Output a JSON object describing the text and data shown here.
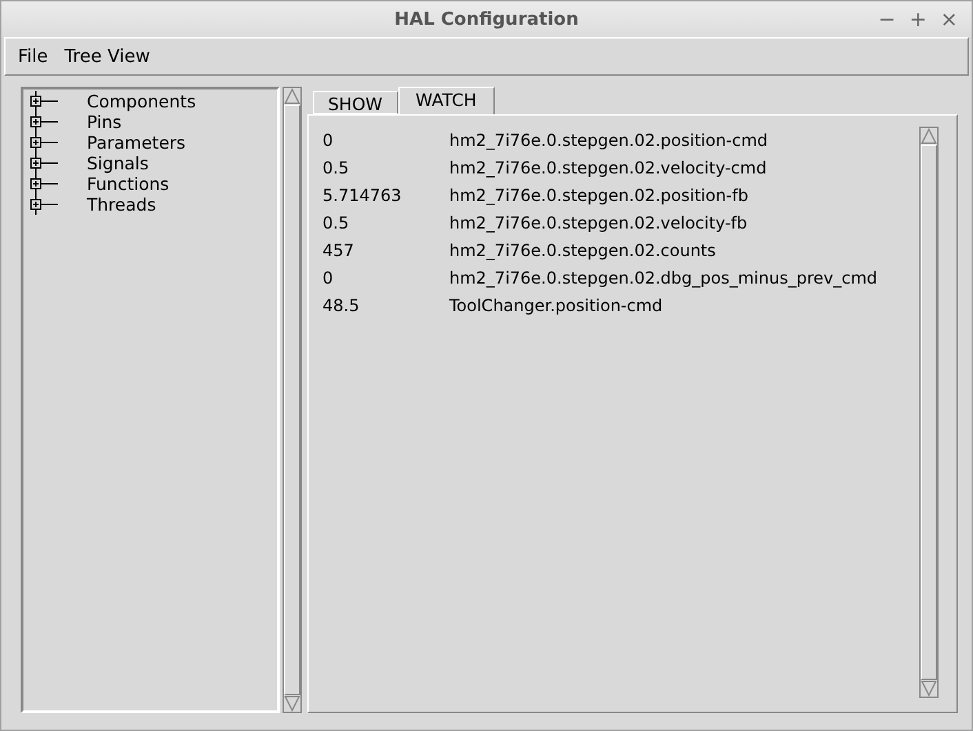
{
  "window": {
    "title": "HAL Configuration",
    "controls": [
      "−",
      "+",
      "×"
    ]
  },
  "menu": [
    "File",
    "Tree View"
  ],
  "tree": {
    "items": [
      {
        "label": "Components",
        "expanded": false
      },
      {
        "label": "Pins",
        "expanded": false
      },
      {
        "label": "Parameters",
        "expanded": false
      },
      {
        "label": "Signals",
        "expanded": false
      },
      {
        "label": "Functions",
        "expanded": false
      },
      {
        "label": "Threads",
        "expanded": false
      }
    ]
  },
  "tabs": [
    {
      "label": "SHOW",
      "selected": false
    },
    {
      "label": "WATCH",
      "selected": true
    }
  ],
  "watch": [
    {
      "value": "0",
      "name": "hm2_7i76e.0.stepgen.02.position-cmd"
    },
    {
      "value": "0.5",
      "name": "hm2_7i76e.0.stepgen.02.velocity-cmd"
    },
    {
      "value": "5.714763",
      "name": "hm2_7i76e.0.stepgen.02.position-fb"
    },
    {
      "value": "0.5",
      "name": "hm2_7i76e.0.stepgen.02.velocity-fb"
    },
    {
      "value": "457",
      "name": "hm2_7i76e.0.stepgen.02.counts"
    },
    {
      "value": "0",
      "name": "hm2_7i76e.0.stepgen.02.dbg_pos_minus_prev_cmd"
    },
    {
      "value": "48.5",
      "name": "ToolChanger.position-cmd"
    }
  ]
}
